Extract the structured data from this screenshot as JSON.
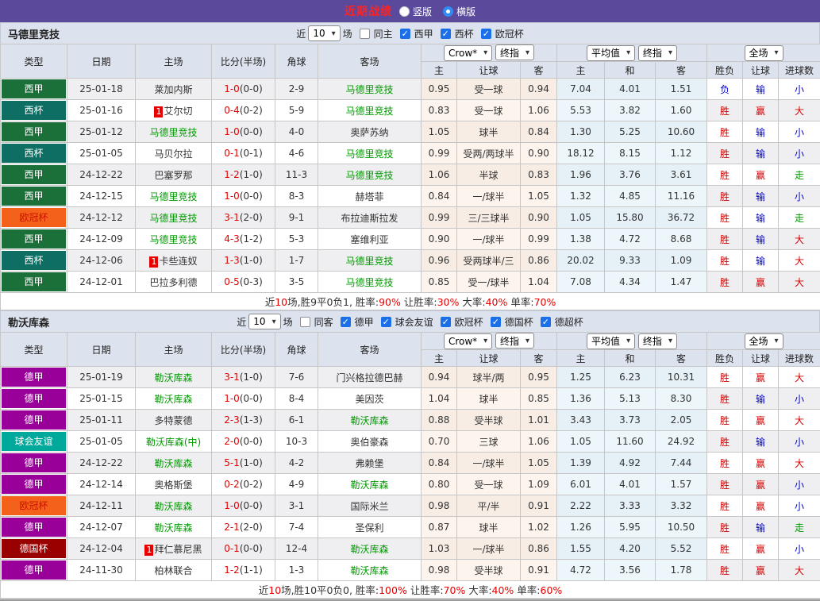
{
  "topbar": {
    "title": "近期战绩",
    "layout_options": [
      {
        "label": "竖版",
        "selected": false
      },
      {
        "label": "横版",
        "selected": true
      }
    ]
  },
  "shared": {
    "near_label": "近",
    "match_label": "场",
    "col_headers": {
      "type": "类型",
      "date": "日期",
      "home": "主场",
      "score": "比分(半场)",
      "corner": "角球",
      "away": "客场",
      "h": "主",
      "hcap": "让球",
      "a": "客",
      "avg_h": "主",
      "avg_d": "和",
      "avg_a": "客",
      "res": "胜负",
      "res_hcap": "让球",
      "res_goals": "进球数"
    },
    "dropdowns": {
      "odds_src": "Crow*",
      "odds_final": "终指",
      "avg": "平均值",
      "avg_final": "终指",
      "scope": "全场"
    }
  },
  "league_styles": {
    "西甲": {
      "bg": "#1a7038",
      "fg": "#ffffff"
    },
    "西杯": {
      "bg": "#0e6e63",
      "fg": "#ffffff"
    },
    "欧冠杯": {
      "bg": "#f4611a",
      "fg": "#cc1100"
    },
    "德甲": {
      "bg": "#990099",
      "fg": "#ffffff"
    },
    "球会友谊": {
      "bg": "#00a99c",
      "fg": "#ffffff"
    },
    "德国杯": {
      "bg": "#990000",
      "fg": "#ffffff"
    }
  },
  "result_colors": {
    "胜": "#d40000",
    "负": "#0000cc",
    "平": "#009900",
    "赢": "#d40000",
    "输": "#0000cc",
    "走": "#009900",
    "大": "#d40000",
    "小": "#0000cc"
  },
  "teams": [
    {
      "name": "马德里竞技",
      "count": "10",
      "same_side_label": "同主",
      "same_side_checked": false,
      "league_filters": [
        {
          "label": "西甲",
          "checked": true
        },
        {
          "label": "西杯",
          "checked": true
        },
        {
          "label": "欧冠杯",
          "checked": true
        }
      ],
      "rows": [
        {
          "league": "西甲",
          "date": "25-01-18",
          "home": "莱加内斯",
          "home_focus": false,
          "home_rank": "",
          "score": "1-0",
          "half": "(0-0)",
          "corners": "2-9",
          "away": "马德里竞技",
          "away_focus": true,
          "away_rank": "",
          "odds_h": "0.95",
          "handicap": "受一球",
          "odds_a": "0.94",
          "avg_h": "7.04",
          "avg_d": "4.01",
          "avg_a": "1.51",
          "res_wdl": "负",
          "res_hcap": "输",
          "res_goal": "小"
        },
        {
          "league": "西杯",
          "date": "25-01-16",
          "home": "艾尔切",
          "home_focus": false,
          "home_rank": "1",
          "score": "0-4",
          "half": "(0-2)",
          "corners": "5-9",
          "away": "马德里竞技",
          "away_focus": true,
          "away_rank": "",
          "odds_h": "0.83",
          "handicap": "受一球",
          "odds_a": "1.06",
          "avg_h": "5.53",
          "avg_d": "3.82",
          "avg_a": "1.60",
          "res_wdl": "胜",
          "res_hcap": "赢",
          "res_goal": "大"
        },
        {
          "league": "西甲",
          "date": "25-01-12",
          "home": "马德里竞技",
          "home_focus": true,
          "home_rank": "",
          "score": "1-0",
          "half": "(0-0)",
          "corners": "4-0",
          "away": "奥萨苏纳",
          "away_focus": false,
          "away_rank": "",
          "odds_h": "1.05",
          "handicap": "球半",
          "odds_a": "0.84",
          "avg_h": "1.30",
          "avg_d": "5.25",
          "avg_a": "10.60",
          "res_wdl": "胜",
          "res_hcap": "输",
          "res_goal": "小"
        },
        {
          "league": "西杯",
          "date": "25-01-05",
          "home": "马贝尔拉",
          "home_focus": false,
          "home_rank": "",
          "score": "0-1",
          "half": "(0-1)",
          "corners": "4-6",
          "away": "马德里竞技",
          "away_focus": true,
          "away_rank": "",
          "odds_h": "0.99",
          "handicap": "受两/两球半",
          "odds_a": "0.90",
          "avg_h": "18.12",
          "avg_d": "8.15",
          "avg_a": "1.12",
          "res_wdl": "胜",
          "res_hcap": "输",
          "res_goal": "小"
        },
        {
          "league": "西甲",
          "date": "24-12-22",
          "home": "巴塞罗那",
          "home_focus": false,
          "home_rank": "",
          "score": "1-2",
          "half": "(1-0)",
          "corners": "11-3",
          "away": "马德里竞技",
          "away_focus": true,
          "away_rank": "",
          "odds_h": "1.06",
          "handicap": "半球",
          "odds_a": "0.83",
          "avg_h": "1.96",
          "avg_d": "3.76",
          "avg_a": "3.61",
          "res_wdl": "胜",
          "res_hcap": "赢",
          "res_goal": "走"
        },
        {
          "league": "西甲",
          "date": "24-12-15",
          "home": "马德里竞技",
          "home_focus": true,
          "home_rank": "",
          "score": "1-0",
          "half": "(0-0)",
          "corners": "8-3",
          "away": "赫塔菲",
          "away_focus": false,
          "away_rank": "",
          "odds_h": "0.84",
          "handicap": "一/球半",
          "odds_a": "1.05",
          "avg_h": "1.32",
          "avg_d": "4.85",
          "avg_a": "11.16",
          "res_wdl": "胜",
          "res_hcap": "输",
          "res_goal": "小"
        },
        {
          "league": "欧冠杯",
          "date": "24-12-12",
          "home": "马德里竞技",
          "home_focus": true,
          "home_rank": "",
          "score": "3-1",
          "half": "(2-0)",
          "corners": "9-1",
          "away": "布拉迪斯拉发",
          "away_focus": false,
          "away_rank": "",
          "odds_h": "0.99",
          "handicap": "三/三球半",
          "odds_a": "0.90",
          "avg_h": "1.05",
          "avg_d": "15.80",
          "avg_a": "36.72",
          "res_wdl": "胜",
          "res_hcap": "输",
          "res_goal": "走"
        },
        {
          "league": "西甲",
          "date": "24-12-09",
          "home": "马德里竞技",
          "home_focus": true,
          "home_rank": "",
          "score": "4-3",
          "half": "(1-2)",
          "corners": "5-3",
          "away": "塞维利亚",
          "away_focus": false,
          "away_rank": "",
          "odds_h": "0.90",
          "handicap": "一/球半",
          "odds_a": "0.99",
          "avg_h": "1.38",
          "avg_d": "4.72",
          "avg_a": "8.68",
          "res_wdl": "胜",
          "res_hcap": "输",
          "res_goal": "大"
        },
        {
          "league": "西杯",
          "date": "24-12-06",
          "home": "卡些连奴",
          "home_focus": false,
          "home_rank": "1",
          "score": "1-3",
          "half": "(1-0)",
          "corners": "1-7",
          "away": "马德里竞技",
          "away_focus": true,
          "away_rank": "",
          "odds_h": "0.96",
          "handicap": "受两球半/三",
          "odds_a": "0.86",
          "avg_h": "20.02",
          "avg_d": "9.33",
          "avg_a": "1.09",
          "res_wdl": "胜",
          "res_hcap": "输",
          "res_goal": "大"
        },
        {
          "league": "西甲",
          "date": "24-12-01",
          "home": "巴拉多利德",
          "home_focus": false,
          "home_rank": "",
          "score": "0-5",
          "half": "(0-3)",
          "corners": "3-5",
          "away": "马德里竞技",
          "away_focus": true,
          "away_rank": "",
          "odds_h": "0.85",
          "handicap": "受一/球半",
          "odds_a": "1.04",
          "avg_h": "7.08",
          "avg_d": "4.34",
          "avg_a": "1.47",
          "res_wdl": "胜",
          "res_hcap": "赢",
          "res_goal": "大"
        }
      ],
      "summary": [
        {
          "t": "近",
          "red": false
        },
        {
          "t": "10",
          "red": true
        },
        {
          "t": "场,胜9平0负1, 胜率:",
          "red": false
        },
        {
          "t": "90%",
          "red": true
        },
        {
          "t": " 让胜率:",
          "red": false
        },
        {
          "t": "30%",
          "red": true
        },
        {
          "t": " 大率:",
          "red": false
        },
        {
          "t": "40%",
          "red": true
        },
        {
          "t": " 单率:",
          "red": false
        },
        {
          "t": "70%",
          "red": true
        }
      ]
    },
    {
      "name": "勒沃库森",
      "count": "10",
      "same_side_label": "同客",
      "same_side_checked": false,
      "league_filters": [
        {
          "label": "德甲",
          "checked": true
        },
        {
          "label": "球会友谊",
          "checked": true
        },
        {
          "label": "欧冠杯",
          "checked": true
        },
        {
          "label": "德国杯",
          "checked": true
        },
        {
          "label": "德超杯",
          "checked": true
        }
      ],
      "rows": [
        {
          "league": "德甲",
          "date": "25-01-19",
          "home": "勒沃库森",
          "home_focus": true,
          "home_rank": "",
          "score": "3-1",
          "half": "(1-0)",
          "corners": "7-6",
          "away": "门兴格拉德巴赫",
          "away_focus": false,
          "away_rank": "",
          "odds_h": "0.94",
          "handicap": "球半/两",
          "odds_a": "0.95",
          "avg_h": "1.25",
          "avg_d": "6.23",
          "avg_a": "10.31",
          "res_wdl": "胜",
          "res_hcap": "赢",
          "res_goal": "大"
        },
        {
          "league": "德甲",
          "date": "25-01-15",
          "home": "勒沃库森",
          "home_focus": true,
          "home_rank": "",
          "score": "1-0",
          "half": "(0-0)",
          "corners": "8-4",
          "away": "美因茨",
          "away_focus": false,
          "away_rank": "",
          "odds_h": "1.04",
          "handicap": "球半",
          "odds_a": "0.85",
          "avg_h": "1.36",
          "avg_d": "5.13",
          "avg_a": "8.30",
          "res_wdl": "胜",
          "res_hcap": "输",
          "res_goal": "小"
        },
        {
          "league": "德甲",
          "date": "25-01-11",
          "home": "多特蒙德",
          "home_focus": false,
          "home_rank": "",
          "score": "2-3",
          "half": "(1-3)",
          "corners": "6-1",
          "away": "勒沃库森",
          "away_focus": true,
          "away_rank": "",
          "odds_h": "0.88",
          "handicap": "受半球",
          "odds_a": "1.01",
          "avg_h": "3.43",
          "avg_d": "3.73",
          "avg_a": "2.05",
          "res_wdl": "胜",
          "res_hcap": "赢",
          "res_goal": "大"
        },
        {
          "league": "球会友谊",
          "date": "25-01-05",
          "home": "勒沃库森(中)",
          "home_focus": true,
          "home_rank": "",
          "score": "2-0",
          "half": "(0-0)",
          "corners": "10-3",
          "away": "奥伯豪森",
          "away_focus": false,
          "away_rank": "",
          "odds_h": "0.70",
          "handicap": "三球",
          "odds_a": "1.06",
          "avg_h": "1.05",
          "avg_d": "11.60",
          "avg_a": "24.92",
          "res_wdl": "胜",
          "res_hcap": "输",
          "res_goal": "小"
        },
        {
          "league": "德甲",
          "date": "24-12-22",
          "home": "勒沃库森",
          "home_focus": true,
          "home_rank": "",
          "score": "5-1",
          "half": "(1-0)",
          "corners": "4-2",
          "away": "弗赖堡",
          "away_focus": false,
          "away_rank": "",
          "odds_h": "0.84",
          "handicap": "一/球半",
          "odds_a": "1.05",
          "avg_h": "1.39",
          "avg_d": "4.92",
          "avg_a": "7.44",
          "res_wdl": "胜",
          "res_hcap": "赢",
          "res_goal": "大"
        },
        {
          "league": "德甲",
          "date": "24-12-14",
          "home": "奥格斯堡",
          "home_focus": false,
          "home_rank": "",
          "score": "0-2",
          "half": "(0-2)",
          "corners": "4-9",
          "away": "勒沃库森",
          "away_focus": true,
          "away_rank": "",
          "odds_h": "0.80",
          "handicap": "受一球",
          "odds_a": "1.09",
          "avg_h": "6.01",
          "avg_d": "4.01",
          "avg_a": "1.57",
          "res_wdl": "胜",
          "res_hcap": "赢",
          "res_goal": "小"
        },
        {
          "league": "欧冠杯",
          "date": "24-12-11",
          "home": "勒沃库森",
          "home_focus": true,
          "home_rank": "",
          "score": "1-0",
          "half": "(0-0)",
          "corners": "3-1",
          "away": "国际米兰",
          "away_focus": false,
          "away_rank": "",
          "odds_h": "0.98",
          "handicap": "平/半",
          "odds_a": "0.91",
          "avg_h": "2.22",
          "avg_d": "3.33",
          "avg_a": "3.32",
          "res_wdl": "胜",
          "res_hcap": "赢",
          "res_goal": "小"
        },
        {
          "league": "德甲",
          "date": "24-12-07",
          "home": "勒沃库森",
          "home_focus": true,
          "home_rank": "",
          "score": "2-1",
          "half": "(2-0)",
          "corners": "7-4",
          "away": "圣保利",
          "away_focus": false,
          "away_rank": "",
          "odds_h": "0.87",
          "handicap": "球半",
          "odds_a": "1.02",
          "avg_h": "1.26",
          "avg_d": "5.95",
          "avg_a": "10.50",
          "res_wdl": "胜",
          "res_hcap": "输",
          "res_goal": "走"
        },
        {
          "league": "德国杯",
          "date": "24-12-04",
          "home": "拜仁慕尼黑",
          "home_focus": false,
          "home_rank": "1",
          "score": "0-1",
          "half": "(0-0)",
          "corners": "12-4",
          "away": "勒沃库森",
          "away_focus": true,
          "away_rank": "",
          "odds_h": "1.03",
          "handicap": "一/球半",
          "odds_a": "0.86",
          "avg_h": "1.55",
          "avg_d": "4.20",
          "avg_a": "5.52",
          "res_wdl": "胜",
          "res_hcap": "赢",
          "res_goal": "小"
        },
        {
          "league": "德甲",
          "date": "24-11-30",
          "home": "柏林联合",
          "home_focus": false,
          "home_rank": "",
          "score": "1-2",
          "half": "(1-1)",
          "corners": "1-3",
          "away": "勒沃库森",
          "away_focus": true,
          "away_rank": "",
          "odds_h": "0.98",
          "handicap": "受半球",
          "odds_a": "0.91",
          "avg_h": "4.72",
          "avg_d": "3.56",
          "avg_a": "1.78",
          "res_wdl": "胜",
          "res_hcap": "赢",
          "res_goal": "大"
        }
      ],
      "summary": [
        {
          "t": "近",
          "red": false
        },
        {
          "t": "10",
          "red": true
        },
        {
          "t": "场,胜10平0负0, 胜率:",
          "red": false
        },
        {
          "t": "100%",
          "red": true
        },
        {
          "t": " 让胜率:",
          "red": false
        },
        {
          "t": "70%",
          "red": true
        },
        {
          "t": " 大率:",
          "red": false
        },
        {
          "t": "40%",
          "red": true
        },
        {
          "t": " 单率:",
          "red": false
        },
        {
          "t": "60%",
          "red": true
        }
      ]
    }
  ]
}
